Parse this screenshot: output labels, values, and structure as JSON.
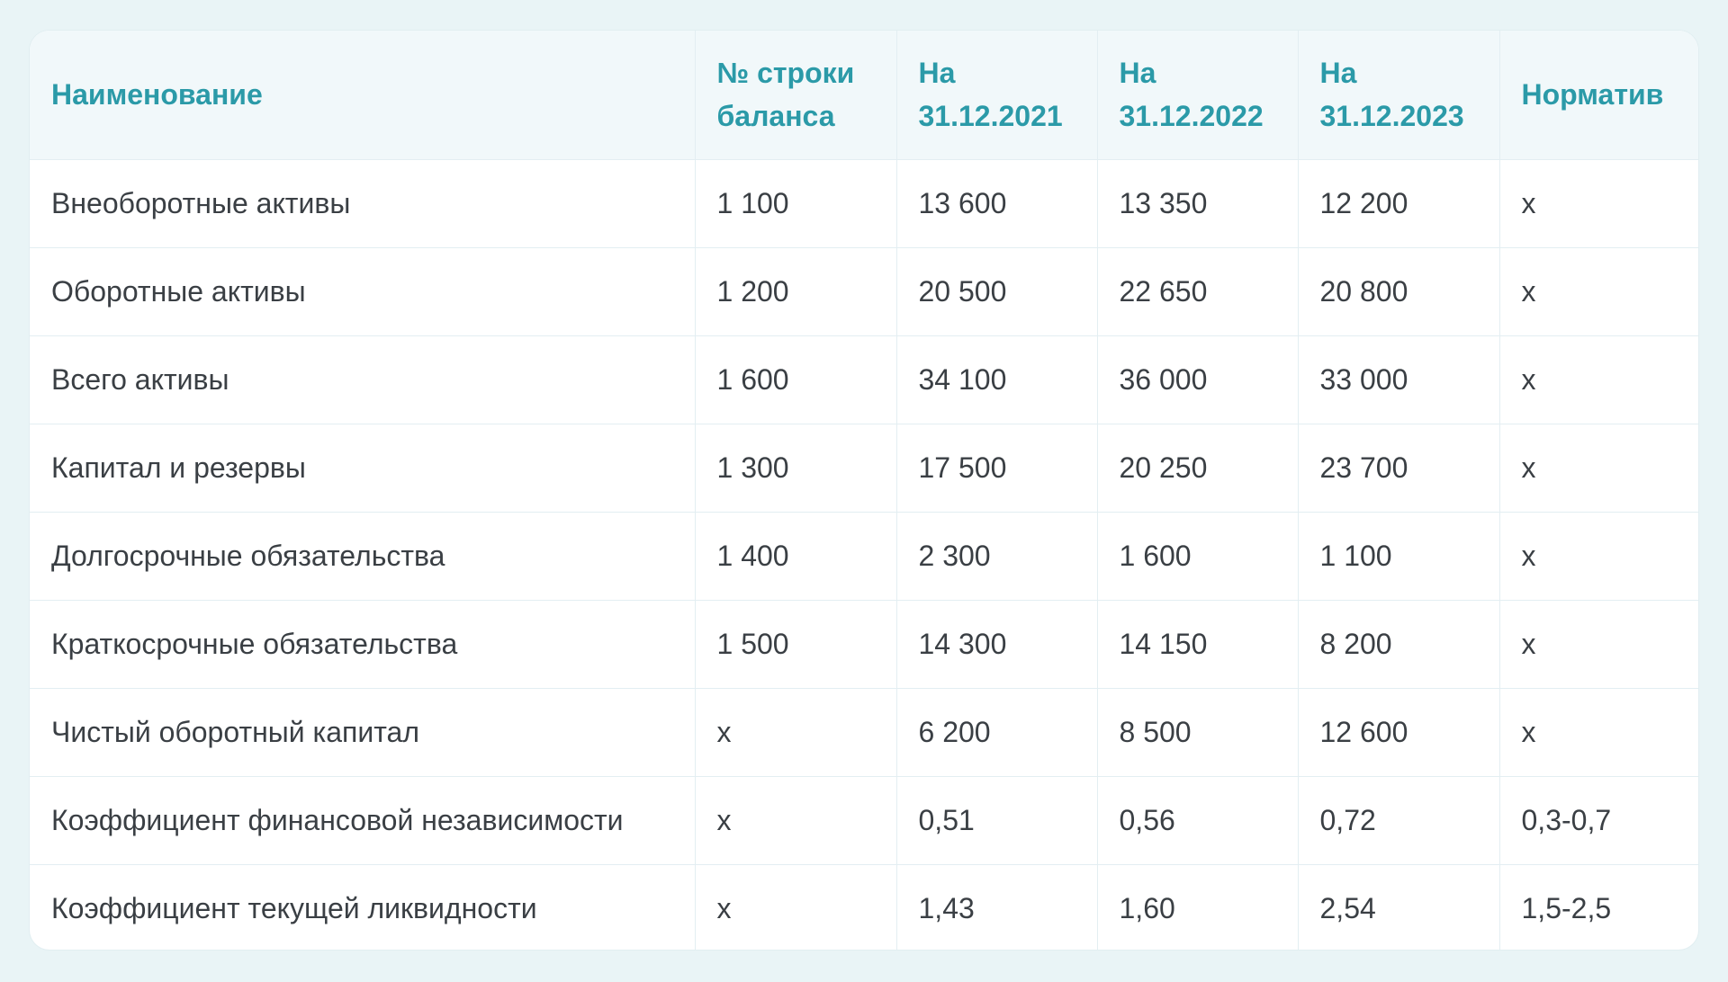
{
  "table": {
    "headers": {
      "name": "Наименование",
      "line_no": "№ строки баланса",
      "y2021": "На 31.12.2021",
      "y2022": "На 31.12.2022",
      "y2023": "На 31.12.2023",
      "norm": "Норматив"
    },
    "rows": [
      {
        "name": "Внеоборотные активы",
        "line": "1 100",
        "v2021": "13 600",
        "v2022": "13 350",
        "v2023": "12 200",
        "norm": "х"
      },
      {
        "name": "Оборотные активы",
        "line": "1 200",
        "v2021": "20 500",
        "v2022": "22 650",
        "v2023": "20 800",
        "norm": "х"
      },
      {
        "name": "Всего активы",
        "line": "1 600",
        "v2021": "34 100",
        "v2022": "36 000",
        "v2023": "33 000",
        "norm": "х"
      },
      {
        "name": "Капитал и резервы",
        "line": "1 300",
        "v2021": "17 500",
        "v2022": "20 250",
        "v2023": "23 700",
        "norm": "х"
      },
      {
        "name": "Долгосрочные обязательства",
        "line": "1 400",
        "v2021": "2 300",
        "v2022": "1 600",
        "v2023": "1 100",
        "norm": "х"
      },
      {
        "name": "Краткосрочные обязательства",
        "line": "1 500",
        "v2021": "14 300",
        "v2022": "14 150",
        "v2023": "8 200",
        "norm": "х"
      },
      {
        "name": "Чистый оборотный капитал",
        "line": "х",
        "v2021": "6 200",
        "v2022": "8 500",
        "v2023": "12 600",
        "norm": "х"
      },
      {
        "name": "Коэффициент финансовой независимости",
        "line": "х",
        "v2021": "0,51",
        "v2022": "0,56",
        "v2023": "0,72",
        "norm": "0,3-0,7"
      },
      {
        "name": "Коэффициент текущей ликвидности",
        "line": "х",
        "v2021": "1,43",
        "v2022": "1,60",
        "v2023": "2,54",
        "norm": "1,5-2,5"
      }
    ]
  }
}
